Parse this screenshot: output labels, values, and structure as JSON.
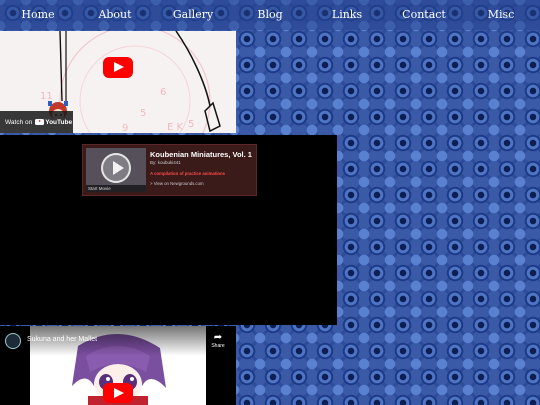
{
  "nav": {
    "items": [
      "Home",
      "About",
      "Gallery",
      "Blog",
      "Links",
      "Contact",
      "Misc"
    ]
  },
  "youtube_embed_1": {
    "watch_on_text": "Watch on",
    "logo_text": "YouTube",
    "play_icon": "youtube-play-icon"
  },
  "newgrounds_embed": {
    "title": "Koubenian Miniatures, Vol. 1",
    "author": "By: koubuki441",
    "description": "A compilation of practice animations",
    "link_text": "> View on Newgrounds.com",
    "start_label": "Start Movie"
  },
  "youtube_embed_2": {
    "title": "Sukuna and her Mallet",
    "share_label": "Share",
    "share_icon": "share-arrow-icon"
  },
  "colors": {
    "youtube_red": "#ff0000",
    "nav_text": "#ffffff",
    "newgrounds_card_bg": "#3b1a1a",
    "newgrounds_desc": "#ff4b4b",
    "page_pattern_blue": "#3a5aa8"
  }
}
